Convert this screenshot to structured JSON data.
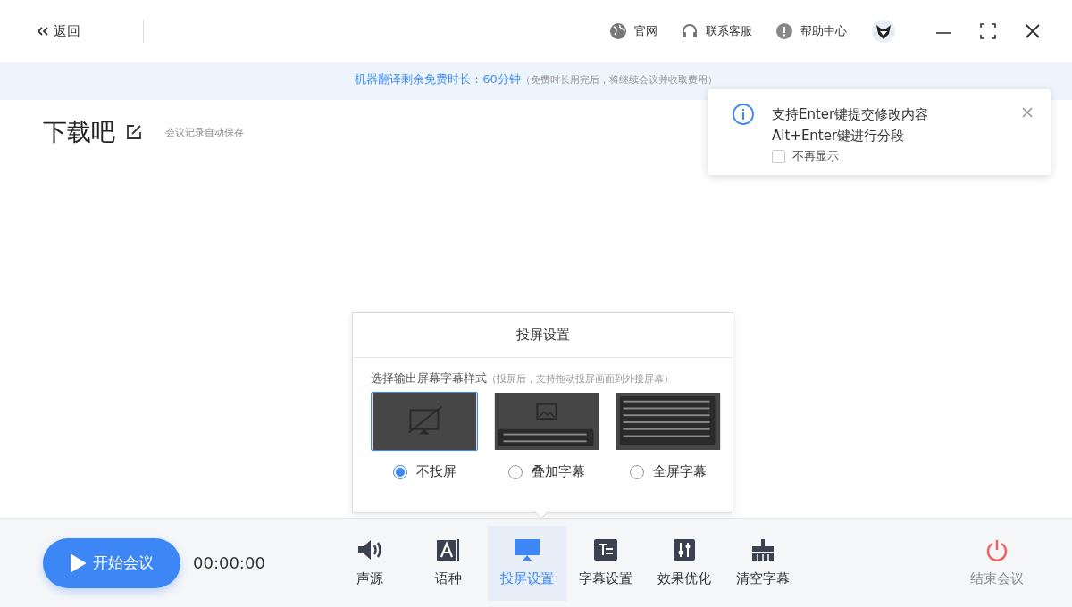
{
  "topbar": {
    "back": "返回",
    "links": [
      {
        "kind": "globe",
        "label": "官网"
      },
      {
        "kind": "headset",
        "label": "联系客服"
      },
      {
        "kind": "help",
        "label": "帮助中心"
      }
    ]
  },
  "banner": {
    "main": "机器翻译剩余免费时长：60分钟",
    "note": "（免费时长用完后，将继续会议并收取费用）"
  },
  "meeting": {
    "title": "下载吧",
    "autosave": "会议记录自动保存"
  },
  "toast": {
    "lines": [
      "支持Enter键提交修改内容",
      "Alt+Enter键进行分段"
    ],
    "checkbox": {
      "label": "不再显示",
      "checked": false
    }
  },
  "popup": {
    "title": "投屏设置",
    "prompt": "选择输出屏幕字幕样式",
    "hint": "（投屏后，支持拖动投屏画面到外接屏幕）",
    "options": [
      {
        "kind": "none",
        "label": "不投屏",
        "selected": true
      },
      {
        "kind": "overlay",
        "label": "叠加字幕",
        "selected": false
      },
      {
        "kind": "fullscreen",
        "label": "全屏字幕",
        "selected": false
      }
    ]
  },
  "bottombar": {
    "start": "开始会议",
    "timer": "00:00:00",
    "tools": [
      {
        "kind": "speaker",
        "label": "声源",
        "selected": false
      },
      {
        "kind": "language",
        "label": "语种",
        "selected": false
      },
      {
        "kind": "cast",
        "label": "投屏设置",
        "selected": true
      },
      {
        "kind": "subtitle",
        "label": "字幕设置",
        "selected": false
      },
      {
        "kind": "tune",
        "label": "效果优化",
        "selected": false
      },
      {
        "kind": "broom",
        "label": "清空字幕",
        "selected": false
      }
    ],
    "end": {
      "label": "结束会议",
      "disabled": true
    }
  }
}
